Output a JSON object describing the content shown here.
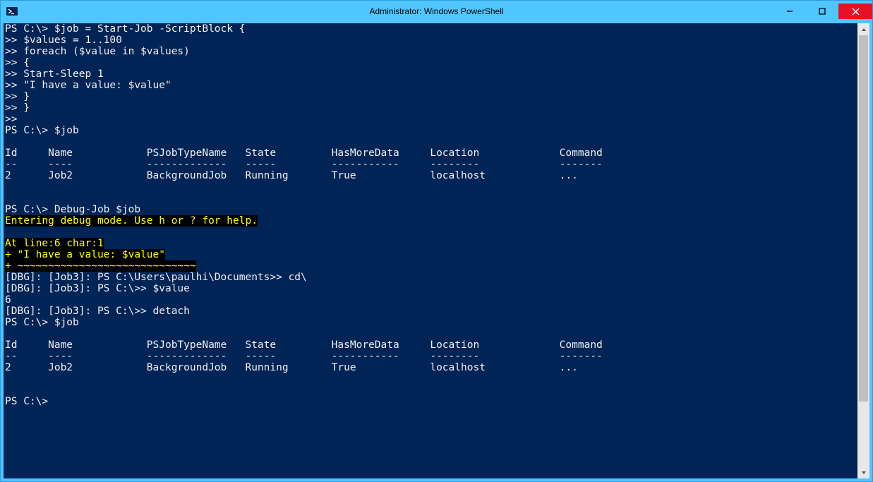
{
  "window": {
    "title": "Administrator: Windows PowerShell"
  },
  "colors": {
    "console_bg": "#012456",
    "console_fg": "#f0f0f0",
    "highlight_bg": "#000000",
    "highlight_fg": "#ffff00",
    "titlebar_bg": "#4fc6ff"
  },
  "lines": [
    {
      "type": "plain",
      "text": "PS C:\\> $job = Start-Job -ScriptBlock {"
    },
    {
      "type": "plain",
      "text": ">> $values = 1..100"
    },
    {
      "type": "plain",
      "text": ">> foreach ($value in $values)"
    },
    {
      "type": "plain",
      "text": ">> {"
    },
    {
      "type": "plain",
      "text": ">> Start-Sleep 1"
    },
    {
      "type": "plain",
      "text": ">> \"I have a value: $value\""
    },
    {
      "type": "plain",
      "text": ">> }"
    },
    {
      "type": "plain",
      "text": ">> }"
    },
    {
      "type": "plain",
      "text": ">>"
    },
    {
      "type": "plain",
      "text": "PS C:\\> $job"
    },
    {
      "type": "plain",
      "text": ""
    },
    {
      "type": "plain",
      "text": "Id     Name            PSJobTypeName   State         HasMoreData     Location             Command"
    },
    {
      "type": "plain",
      "text": "--     ----            -------------   -----         -----------     --------             -------"
    },
    {
      "type": "plain",
      "text": "2      Job2            BackgroundJob   Running       True            localhost            ..."
    },
    {
      "type": "plain",
      "text": ""
    },
    {
      "type": "plain",
      "text": ""
    },
    {
      "type": "plain",
      "text": "PS C:\\> Debug-Job $job"
    },
    {
      "type": "hl",
      "text": "Entering debug mode. Use h or ? for help."
    },
    {
      "type": "plain",
      "text": ""
    },
    {
      "type": "hl",
      "text": "At line:6 char:1"
    },
    {
      "type": "hl",
      "text": "+ \"I have a value: $value\""
    },
    {
      "type": "hl",
      "text": "+ ~~~~~~~~~~~~~~~~~~~~~~~~~~~~~"
    },
    {
      "type": "plain",
      "text": "[DBG]: [Job3]: PS C:\\Users\\paulhi\\Documents>> cd\\"
    },
    {
      "type": "plain",
      "text": "[DBG]: [Job3]: PS C:\\>> $value"
    },
    {
      "type": "plain",
      "text": "6"
    },
    {
      "type": "plain",
      "text": "[DBG]: [Job3]: PS C:\\>> detach"
    },
    {
      "type": "plain",
      "text": "PS C:\\> $job"
    },
    {
      "type": "plain",
      "text": ""
    },
    {
      "type": "plain",
      "text": "Id     Name            PSJobTypeName   State         HasMoreData     Location             Command"
    },
    {
      "type": "plain",
      "text": "--     ----            -------------   -----         -----------     --------             -------"
    },
    {
      "type": "plain",
      "text": "2      Job2            BackgroundJob   Running       True            localhost            ..."
    },
    {
      "type": "plain",
      "text": ""
    },
    {
      "type": "plain",
      "text": ""
    },
    {
      "type": "plain",
      "text": "PS C:\\>"
    }
  ],
  "job_table": {
    "headers": [
      "Id",
      "Name",
      "PSJobTypeName",
      "State",
      "HasMoreData",
      "Location",
      "Command"
    ],
    "rows": [
      {
        "Id": "2",
        "Name": "Job2",
        "PSJobTypeName": "BackgroundJob",
        "State": "Running",
        "HasMoreData": "True",
        "Location": "localhost",
        "Command": "..."
      }
    ]
  }
}
